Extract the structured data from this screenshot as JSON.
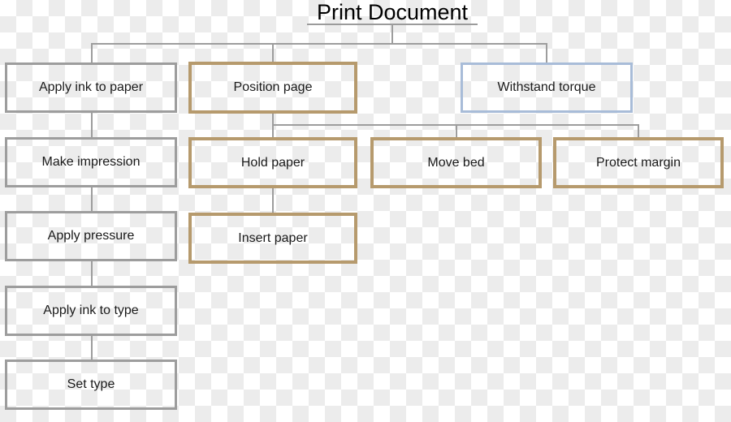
{
  "diagram": {
    "type": "tree",
    "title": "Print Document",
    "colors": {
      "gray_border": "#9d9d9d",
      "brown_border": "#b69a6d",
      "blue_border": "#a8bcd8",
      "connector": "#9d9d9d",
      "text": "#1a1a1a",
      "canvas_light": "#ffffff",
      "canvas_dark": "#ececec"
    },
    "nodes": [
      {
        "id": "apply-ink-to-paper",
        "label": "Apply ink to paper",
        "style": "gray"
      },
      {
        "id": "make-impression",
        "label": "Make impression",
        "style": "gray"
      },
      {
        "id": "apply-pressure",
        "label": "Apply pressure",
        "style": "gray"
      },
      {
        "id": "apply-ink-to-type",
        "label": "Apply ink to type",
        "style": "gray"
      },
      {
        "id": "set-type",
        "label": "Set type",
        "style": "gray"
      },
      {
        "id": "position-page",
        "label": "Position page",
        "style": "brown"
      },
      {
        "id": "hold-paper",
        "label": "Hold paper",
        "style": "brown"
      },
      {
        "id": "insert-paper",
        "label": "Insert paper",
        "style": "brown"
      },
      {
        "id": "move-bed",
        "label": "Move bed",
        "style": "brown"
      },
      {
        "id": "protect-margin",
        "label": "Protect margin",
        "style": "brown"
      },
      {
        "id": "withstand-torque",
        "label": "Withstand torque",
        "style": "blue"
      }
    ],
    "edges": [
      {
        "from": "Print Document",
        "to": "Apply ink to paper"
      },
      {
        "from": "Print Document",
        "to": "Position page"
      },
      {
        "from": "Print Document",
        "to": "Withstand torque"
      },
      {
        "from": "Apply ink to paper",
        "to": "Make impression"
      },
      {
        "from": "Make impression",
        "to": "Apply pressure"
      },
      {
        "from": "Apply pressure",
        "to": "Apply ink to type"
      },
      {
        "from": "Apply ink to type",
        "to": "Set type"
      },
      {
        "from": "Position page",
        "to": "Hold paper"
      },
      {
        "from": "Position page",
        "to": "Move bed"
      },
      {
        "from": "Position page",
        "to": "Protect margin"
      },
      {
        "from": "Hold paper",
        "to": "Insert paper"
      }
    ]
  }
}
